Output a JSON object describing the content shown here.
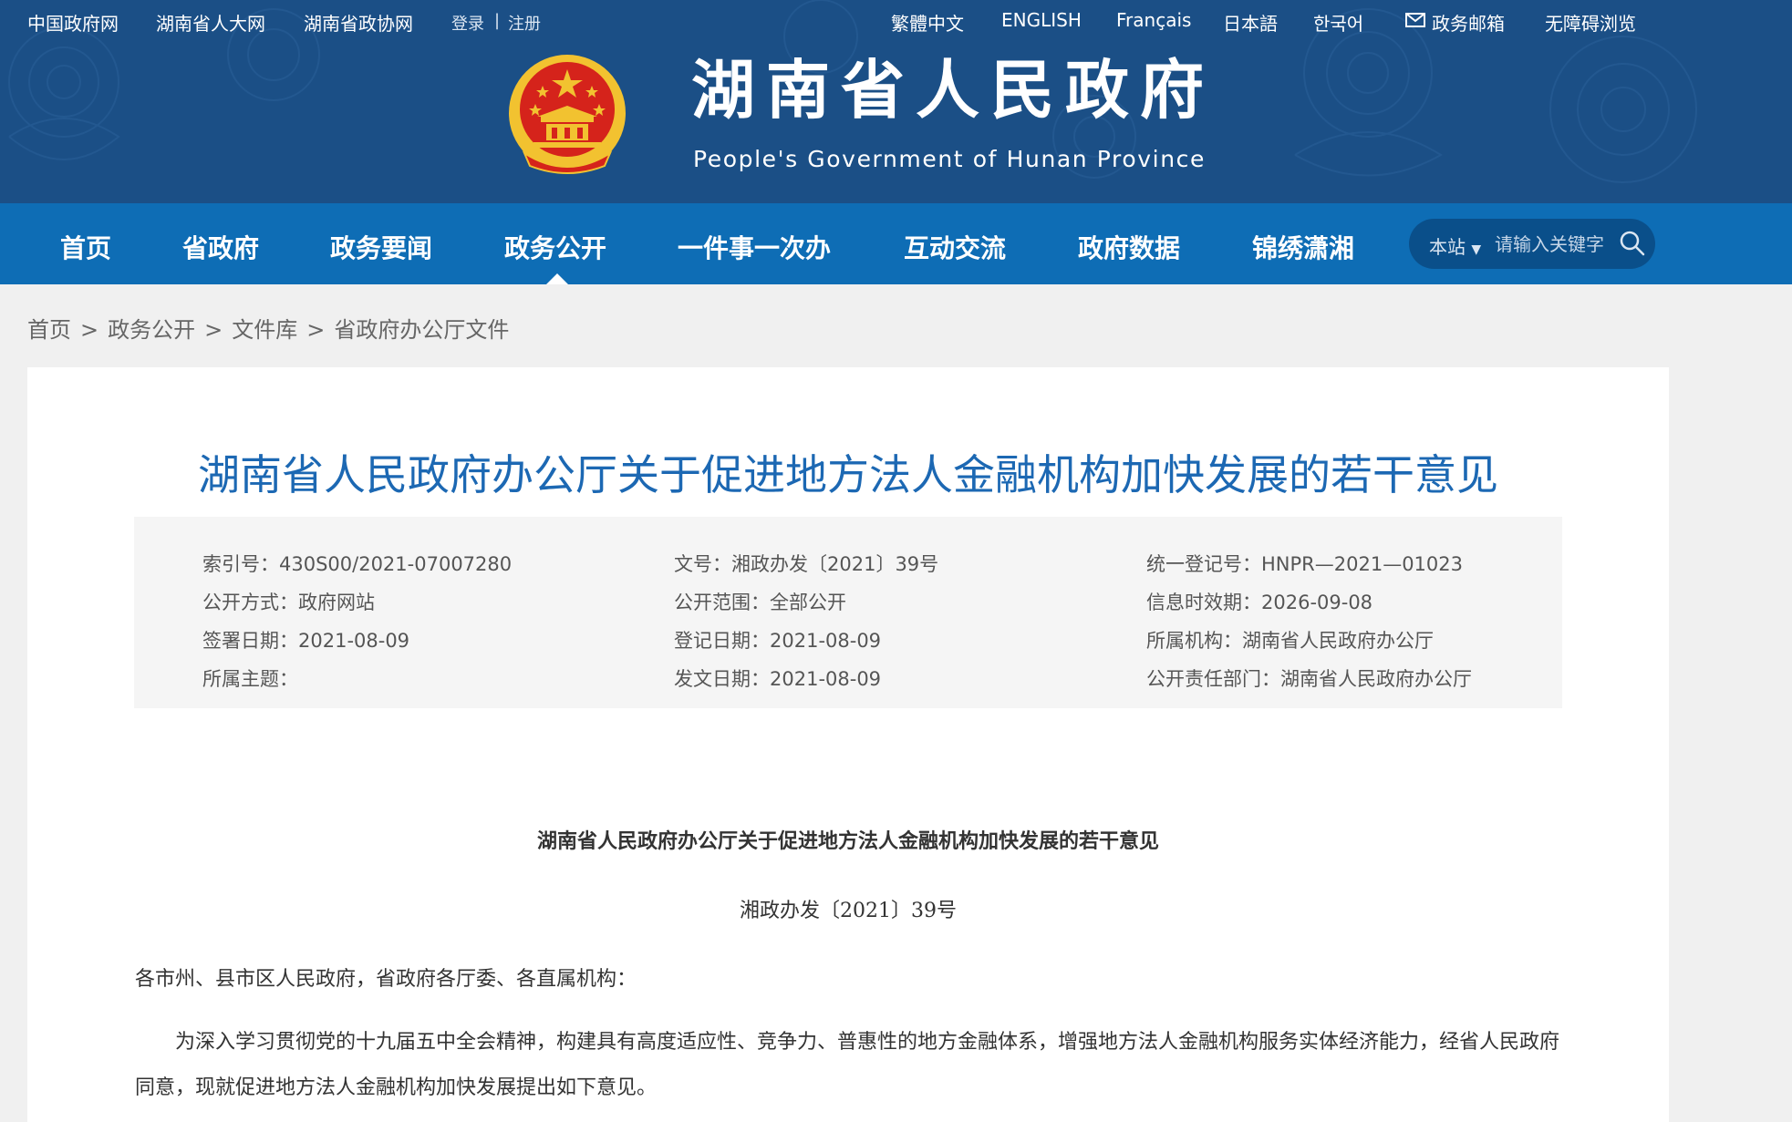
{
  "top_links": {
    "china_gov": "中国政府网",
    "hunan_npc": "湖南省人大网",
    "hunan_cppcc": "湖南省政协网",
    "login": "登录",
    "separator": "|",
    "register": "注册",
    "traditional_chinese": "繁體中文",
    "english": "ENGLISH",
    "french": "Français",
    "japanese": "日本語",
    "korean": "한국어",
    "gov_mail": "政务邮箱",
    "accessible": "无障碍浏览"
  },
  "header": {
    "title": "湖南省人民政府",
    "subtitle": "People's Government of Hunan Province"
  },
  "nav": {
    "items": [
      "首页",
      "省政府",
      "政务要闻",
      "政务公开",
      "一件事一次办",
      "互动交流",
      "政府数据",
      "锦绣潇湘"
    ],
    "active_index": 3
  },
  "search": {
    "scope": "本站",
    "placeholder": "请输入关键字"
  },
  "breadcrumb": {
    "items": [
      "首页",
      "政务公开",
      "文件库",
      "省政府办公厅文件"
    ],
    "separator": ">"
  },
  "document": {
    "title": "湖南省人民政府办公厅关于促进地方法人金融机构加快发展的若干意见",
    "meta": {
      "index_no": "索引号：430S00/2021-07007280",
      "doc_no": "文号：湘政办发〔2021〕39号",
      "reg_no": "统一登记号：HNPR—2021—01023",
      "pub_method": "公开方式：政府网站",
      "pub_scope": "公开范围：全部公开",
      "validity": "信息时效期：2026-09-08",
      "sign_date": "签署日期：2021-08-09",
      "reg_date": "登记日期：2021-08-09",
      "agency": "所属机构：湖南省人民政府办公厅",
      "topic": "所属主题：",
      "issue_date": "发文日期：2021-08-09",
      "dept": "公开责任部门：湖南省人民政府办公厅"
    },
    "body_title": "湖南省人民政府办公厅关于促进地方法人金融机构加快发展的若干意见",
    "body_code": "湘政办发〔2021〕39号",
    "addressee": "各市州、县市区人民政府，省政府各厅委、各直属机构：",
    "paragraph": "为深入学习贯彻党的十九届五中全会精神，构建具有高度适应性、竞争力、普惠性的地方金融体系，增强地方法人金融机构服务实体经济能力，经省人民政府同意，现就促进地方法人金融机构加快发展提出如下意见。"
  },
  "colors": {
    "header_bg": "#1b4f86",
    "nav_bg": "#0e6db5",
    "title_blue": "#1c68b3",
    "emblem_red": "#d5231b",
    "emblem_gold": "#f2c230"
  }
}
